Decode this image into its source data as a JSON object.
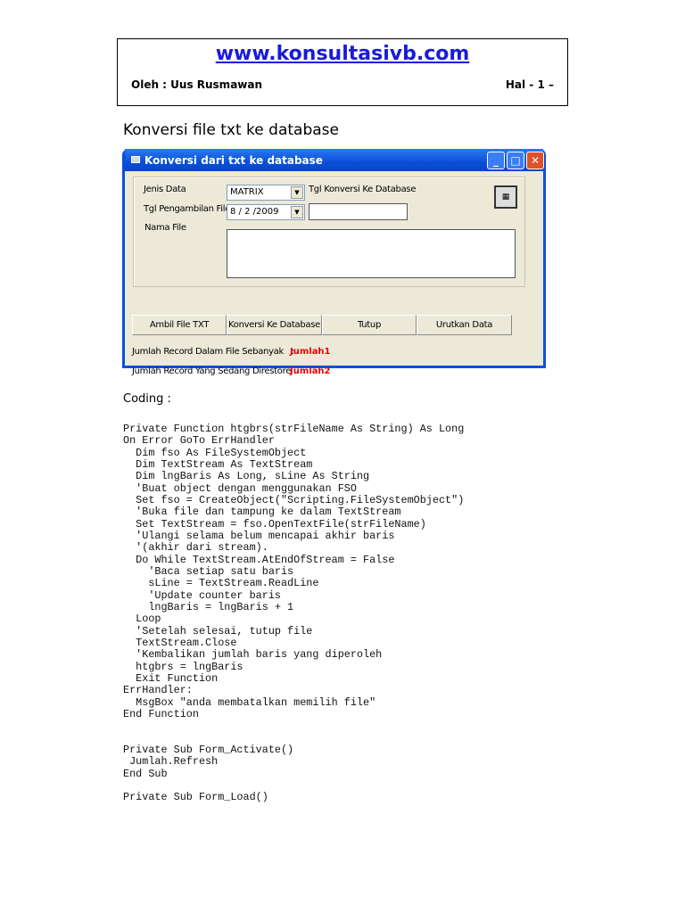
{
  "header": {
    "site": "www.konsultasivb.com",
    "author": "Oleh : Uus Rusmawan",
    "page": "Hal - 1 –"
  },
  "heading": "Konversi file txt ke database",
  "window": {
    "title": "Konversi dari txt ke database",
    "labels": {
      "jenis_data": "Jenis Data",
      "tgl_pengambilan": "Tgl Pengambilan File",
      "nama_file": "Nama File",
      "tgl_konversi": "Tgl Konversi Ke Database"
    },
    "jenis_data_value": "MATRIX",
    "tgl_pengambilan_value": "8 / 2 /2009",
    "tgl_konversi_value": "",
    "nama_file_value": "",
    "buttons": [
      "Ambil File TXT",
      "Konversi Ke Database",
      "Tutup",
      "Urutkan Data"
    ],
    "status": [
      {
        "label": "Jumlah Record Dalam File Sebanyak   :",
        "value": "Jumlah1"
      },
      {
        "label": "Jumlah Record Yang Sedang Direstore :",
        "value": "Jumlah2"
      }
    ]
  },
  "coding_label": "Coding :",
  "code": [
    "Private Function htgbrs(strFileName As String) As Long",
    "On Error GoTo ErrHandler",
    "  Dim fso As FileSystemObject",
    "  Dim TextStream As TextStream",
    "  Dim lngBaris As Long, sLine As String",
    "  'Buat object dengan menggunakan FSO",
    "  Set fso = CreateObject(\"Scripting.FileSystemObject\")",
    "  'Buka file dan tampung ke dalam TextStream",
    "  Set TextStream = fso.OpenTextFile(strFileName)",
    "  'Ulangi selama belum mencapai akhir baris",
    "  '(akhir dari stream).",
    "  Do While TextStream.AtEndOfStream = False",
    "    'Baca setiap satu baris",
    "    sLine = TextStream.ReadLine",
    "    'Update counter baris",
    "    lngBaris = lngBaris + 1",
    "  Loop",
    "  'Setelah selesai, tutup file",
    "  TextStream.Close",
    "  'Kembalikan jumlah baris yang diperoleh",
    "  htgbrs = lngBaris",
    "  Exit Function",
    "ErrHandler:",
    "  MsgBox \"anda membatalkan memilih file\"",
    "End Function",
    "",
    "",
    "Private Sub Form_Activate()",
    " Jumlah.Refresh",
    "End Sub",
    "",
    "Private Sub Form_Load()"
  ]
}
